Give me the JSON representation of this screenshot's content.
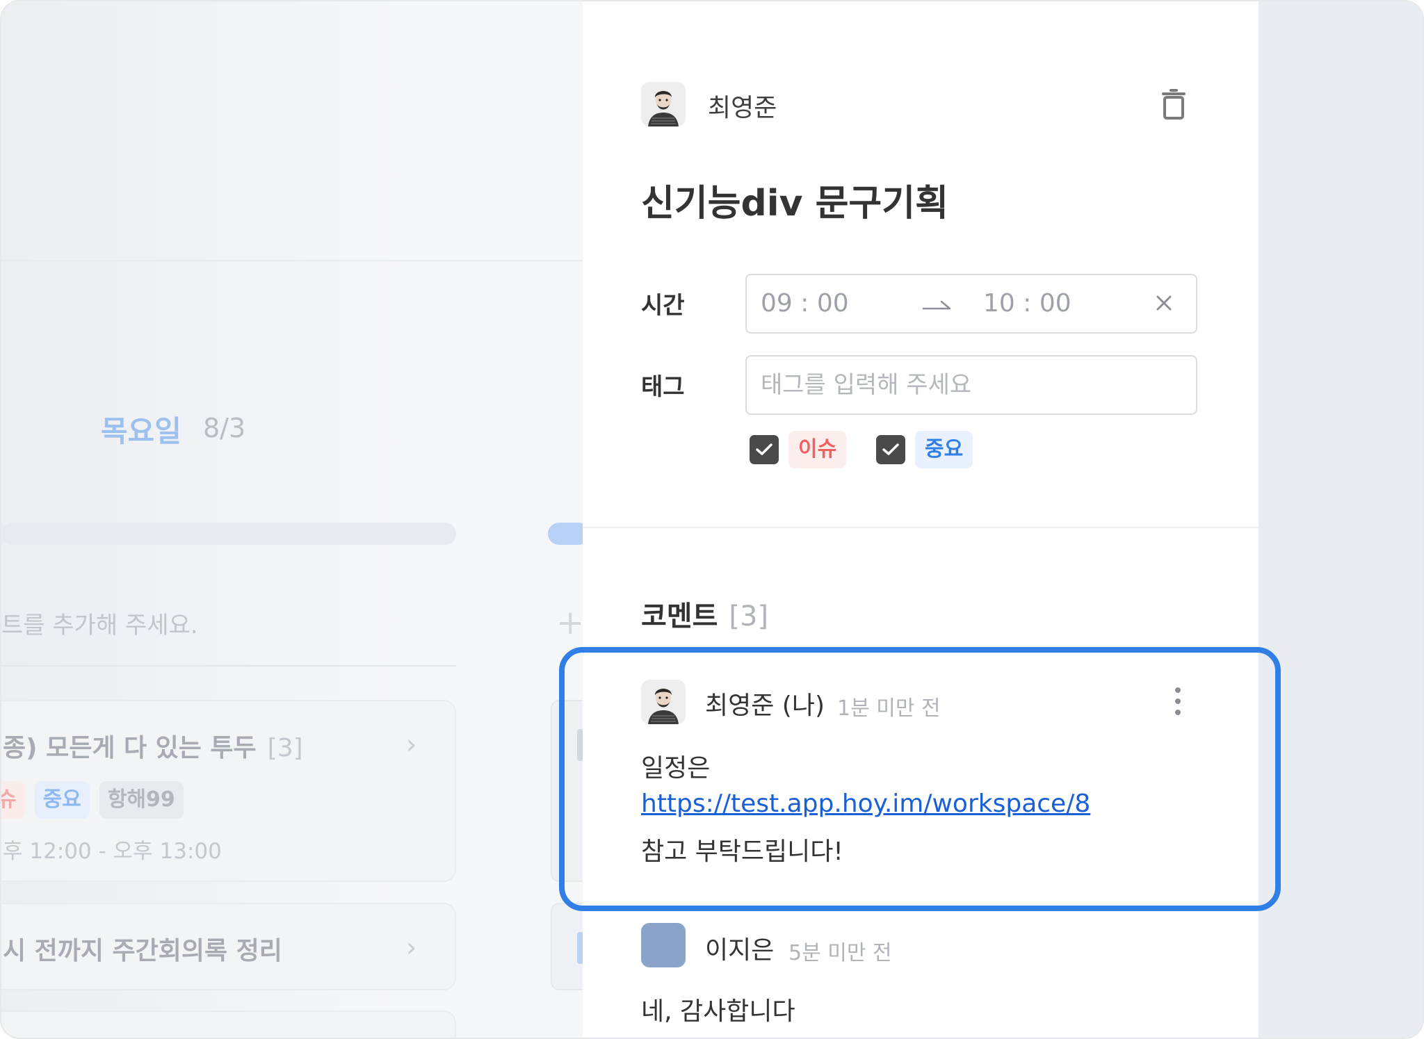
{
  "background_list": {
    "day": "목요일",
    "date": "8/3",
    "add_placeholder": "트를 추가해 주세요.",
    "add_icon": "plus-icon",
    "card1": {
      "title": "종) 모든게 다 있는 투두",
      "count": "[3]",
      "tags": [
        "슈",
        "중요",
        "항해99"
      ],
      "time": "후 12:00 - 오후 13:00"
    },
    "card2": {
      "title": "시 전까지 주간회의록 정리"
    }
  },
  "detail": {
    "author": "최영준",
    "delete_icon": "trash-icon",
    "title": "신기능div 문구기획",
    "time_label": "시간",
    "time_start": "09 : 00",
    "time_end": "10 : 00",
    "tag_label": "태그",
    "tag_placeholder": "태그를 입력해 주세요",
    "tags": [
      {
        "label": "이슈",
        "checked": true,
        "color": "#f06262"
      },
      {
        "label": "중요",
        "checked": true,
        "color": "#2f7fe6"
      }
    ]
  },
  "comments": {
    "heading": "코멘트",
    "count": "[3]",
    "items": [
      {
        "author": "최영준 (나)",
        "time": "1분 미만 전",
        "lines": [
          "일정은",
          "https://test.app.hoy.im/workspace/8",
          "참고 부탁드립니다!"
        ],
        "link": "https://test.app.hoy.im/workspace/8",
        "menu_icon": "more-vertical-icon"
      },
      {
        "author": "이지은",
        "time": "5분 미만 전",
        "text": "네, 감사합니다"
      }
    ]
  },
  "colors": {
    "accent": "#2f7fe6",
    "issue": "#f06262",
    "avatar_placeholder": "#8aa3c8"
  }
}
